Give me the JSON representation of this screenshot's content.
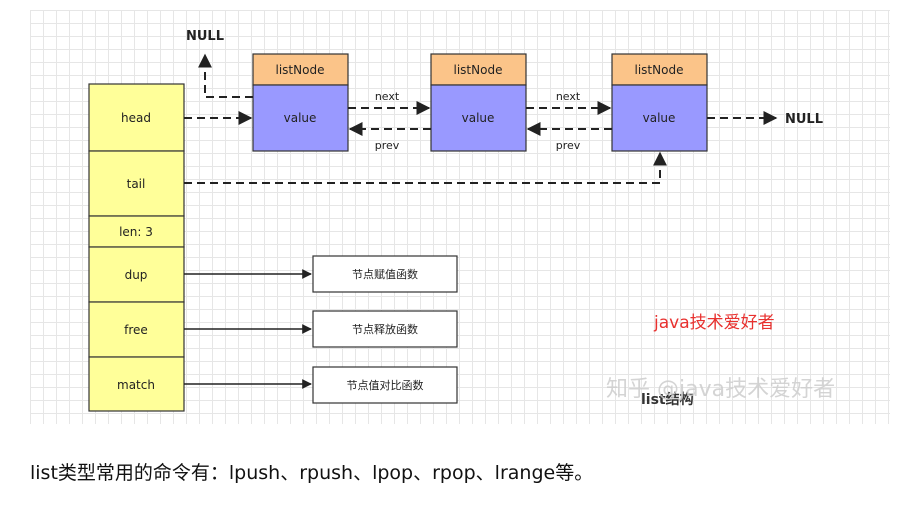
{
  "diagram": {
    "null_top": "NULL",
    "null_right": "NULL",
    "node_header": "listNode",
    "node_value": "value",
    "next_label": "next",
    "prev_label": "prev",
    "list_fields": [
      "head",
      "tail",
      "len: 3",
      "dup",
      "free",
      "match"
    ],
    "functions": [
      "节点赋值函数",
      "节点释放函数",
      "节点值对比函数"
    ],
    "watermark_author": "java技术爱好者",
    "watermark_zhihu": "知乎 @java技术爱好者",
    "diagram_title": "list结构"
  },
  "caption": "list类型常用的命令有：lpush、rpush、lpop、rpop、lrange等。",
  "colors": {
    "list_fill": "#ffff99",
    "node_header_fill": "#fbc489",
    "node_value_fill": "#9999ff",
    "author_red": "#e8312f",
    "watermark_grey": "#d0d0d0"
  }
}
